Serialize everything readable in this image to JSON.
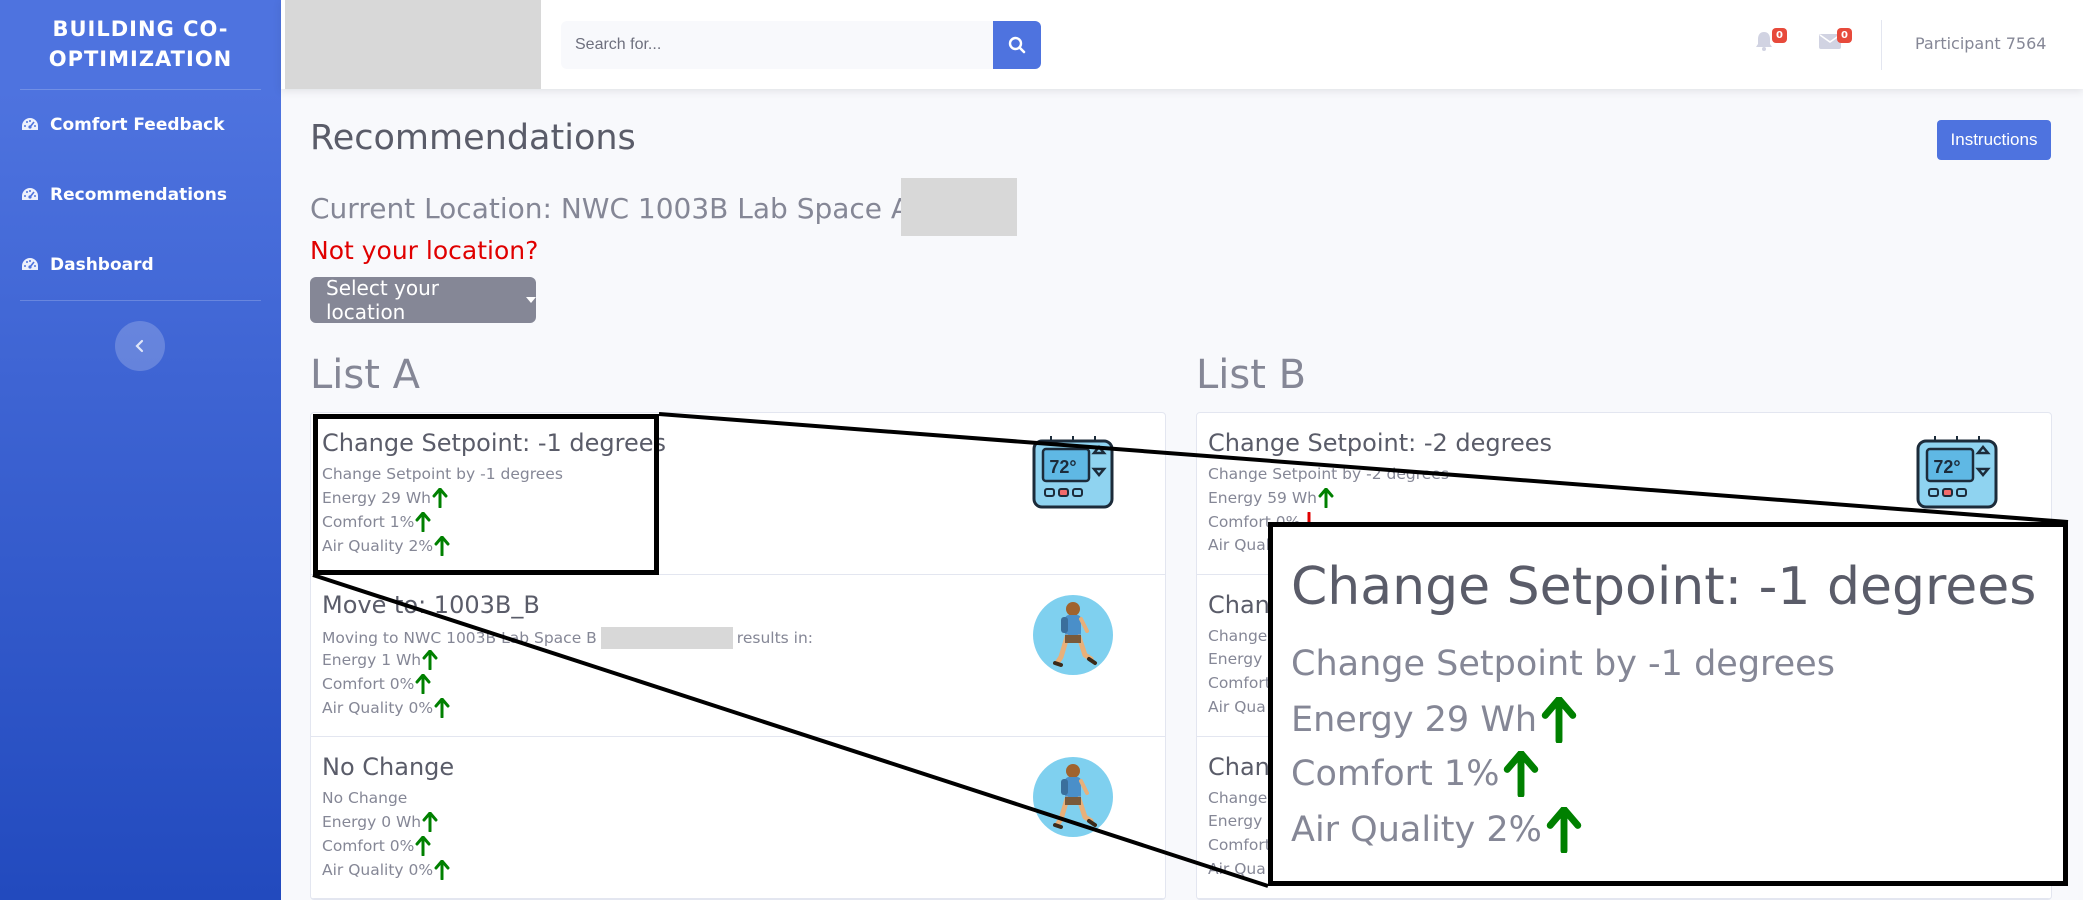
{
  "sidebar": {
    "brand": "BUILDING CO-OPTIMIZATION",
    "items": [
      {
        "label": "Comfort Feedback",
        "icon": "tachometer-icon"
      },
      {
        "label": "Recommendations",
        "icon": "tachometer-icon"
      },
      {
        "label": "Dashboard",
        "icon": "tachometer-icon"
      }
    ]
  },
  "topbar": {
    "search_placeholder": "Search for...",
    "alerts_count": "0",
    "messages_count": "0",
    "user": "Participant 7564"
  },
  "main": {
    "title": "Recommendations",
    "instructions_label": "Instructions",
    "current_location": "Current Location: NWC 1003B Lab Space A",
    "not_location": "Not your location?",
    "select_location_label": "Select your location"
  },
  "list_a": {
    "title": "List A",
    "items": [
      {
        "title": "Change Setpoint: -1 degrees",
        "desc": "Change Setpoint by -1 degrees",
        "energy": "Energy 29 Wh",
        "comfort": "Comfort 1%",
        "air": "Air Quality 2%"
      },
      {
        "title": "Move to: 1003B_B",
        "desc_prefix": "Moving to NWC 1003B Lab Space B",
        "desc_suffix": "results in:",
        "energy": "Energy 1 Wh",
        "comfort": "Comfort 0%",
        "air": "Air Quality 0%"
      },
      {
        "title": "No Change",
        "desc": "No Change",
        "energy": "Energy 0 Wh",
        "comfort": "Comfort 0%",
        "air": "Air Quality 0%"
      }
    ]
  },
  "list_b": {
    "title": "List B",
    "items": [
      {
        "title": "Change Setpoint: -2 degrees",
        "desc": "Change Setpoint by -2 degrees",
        "energy": "Energy 59 Wh",
        "comfort": "Comfort 0%",
        "air": "Air Qual"
      },
      {
        "title": "Chan",
        "desc": "Change",
        "energy": "Energy",
        "comfort": "Comfort",
        "air": "Air Qua"
      },
      {
        "title": "Chan",
        "desc": "Change",
        "energy": "Energy",
        "comfort": "Comfort",
        "air": "Air Qua"
      }
    ]
  },
  "thermostat_display": "72°",
  "zoom": {
    "title": "Change Setpoint: -1 degrees",
    "desc": "Change Setpoint by -1 degrees",
    "energy": "Energy 29 Wh",
    "comfort": "Comfort 1%",
    "air": "Air Quality 2%"
  },
  "colors": {
    "primary": "#4e73df",
    "up_arrow": "#008000",
    "down_arrow": "#e00000",
    "warning": "#e00000"
  }
}
